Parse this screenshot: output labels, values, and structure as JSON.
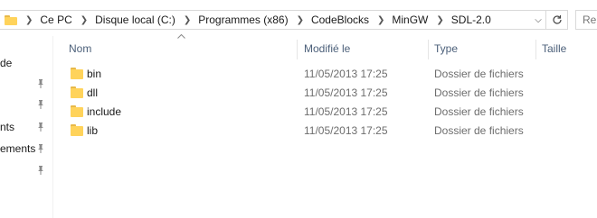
{
  "address_bar": {
    "crumbs": [
      "Ce PC",
      "Disque local (C:)",
      "Programmes (x86)",
      "CodeBlocks",
      "MinGW",
      "SDL-2.0"
    ]
  },
  "search": {
    "placeholder": "Re"
  },
  "nav_pane": {
    "items": [
      {
        "label": "de",
        "pinned": false
      },
      {
        "label": "",
        "pinned": true
      },
      {
        "label": "",
        "pinned": true
      },
      {
        "label": "nts",
        "pinned": true
      },
      {
        "label": "ements",
        "pinned": true
      },
      {
        "label": "",
        "pinned": true
      }
    ]
  },
  "columns": {
    "name": "Nom",
    "modified": "Modifié le",
    "type": "Type",
    "size": "Taille"
  },
  "files": [
    {
      "name": "bin",
      "modified": "11/05/2013 17:25",
      "type": "Dossier de fichiers",
      "icon": "folder-icon"
    },
    {
      "name": "dll",
      "modified": "11/05/2013 17:25",
      "type": "Dossier de fichiers",
      "icon": "folder-icon"
    },
    {
      "name": "include",
      "modified": "11/05/2013 17:25",
      "type": "Dossier de fichiers",
      "icon": "folder-icon"
    },
    {
      "name": "lib",
      "modified": "11/05/2013 17:25",
      "type": "Dossier de fichiers",
      "icon": "folder-icon"
    }
  ],
  "colors": {
    "folder": "#ffd35b",
    "header_text": "#4c607a",
    "secondary_text": "#6d6d6d"
  }
}
